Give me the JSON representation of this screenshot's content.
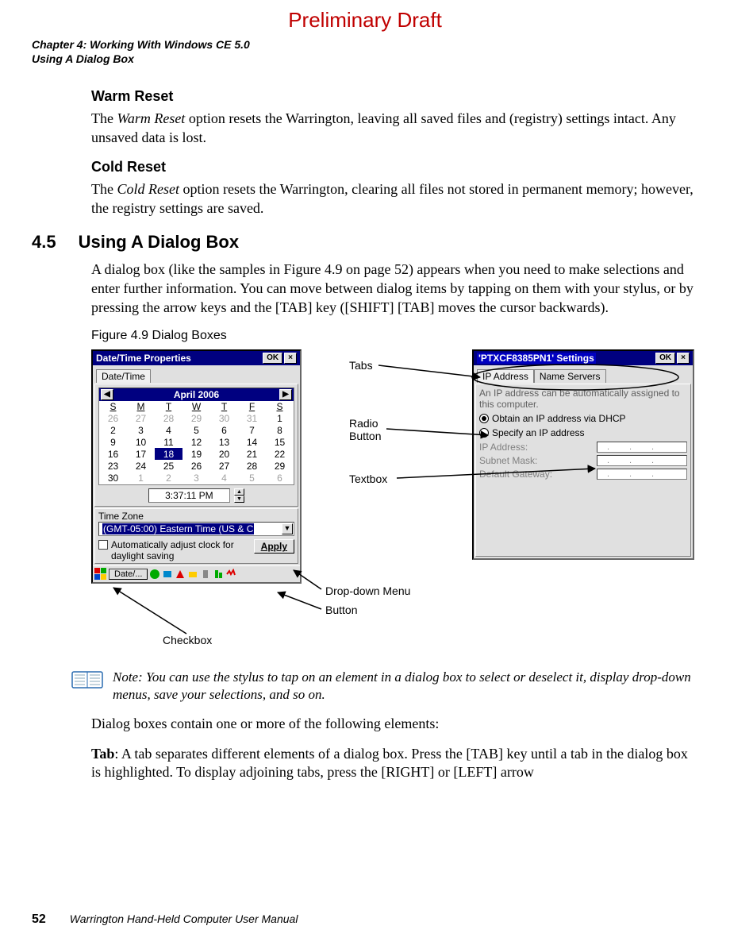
{
  "watermark": "Preliminary Draft",
  "running_head": {
    "chapter": "Chapter 4:  Working With Windows CE 5.0",
    "section": "Using A Dialog Box"
  },
  "warm_reset": {
    "heading": "Warm Reset",
    "body_pre": "The ",
    "body_em": "Warm Reset",
    "body_post": " option resets the Warrington, leaving all saved files and (registry) settings intact. Any unsaved data is lost."
  },
  "cold_reset": {
    "heading": "Cold Reset",
    "body_pre": "The ",
    "body_em": "Cold Reset",
    "body_post": " option resets the Warrington, clearing all files not stored in permanent memory; however, the registry settings are saved."
  },
  "section45": {
    "num": "4.5",
    "title": "Using A Dialog Box",
    "body": "A dialog box (like the samples in Figure 4.9 on page 52) appears when you need to make selections and enter further information. You can move between dialog items by tapping on them with your stylus, or by pressing the arrow keys and the [TAB] key ([SHIFT] [TAB] moves the cursor backwards)."
  },
  "fig_caption": "Figure 4.9  Dialog Boxes",
  "win1": {
    "title": "Date/Time Properties",
    "ok": "OK",
    "close": "×",
    "tab": "Date/Time",
    "month": "April 2006",
    "dow": [
      "S",
      "M",
      "T",
      "W",
      "T",
      "F",
      "S"
    ],
    "grid": [
      [
        {
          "v": "26",
          "d": 1
        },
        {
          "v": "27",
          "d": 1
        },
        {
          "v": "28",
          "d": 1
        },
        {
          "v": "29",
          "d": 1
        },
        {
          "v": "30",
          "d": 1
        },
        {
          "v": "31",
          "d": 1
        },
        {
          "v": "1",
          "d": 0
        }
      ],
      [
        {
          "v": "2",
          "d": 0
        },
        {
          "v": "3",
          "d": 0
        },
        {
          "v": "4",
          "d": 0
        },
        {
          "v": "5",
          "d": 0
        },
        {
          "v": "6",
          "d": 0
        },
        {
          "v": "7",
          "d": 0
        },
        {
          "v": "8",
          "d": 0
        }
      ],
      [
        {
          "v": "9",
          "d": 0
        },
        {
          "v": "10",
          "d": 0
        },
        {
          "v": "11",
          "d": 0
        },
        {
          "v": "12",
          "d": 0
        },
        {
          "v": "13",
          "d": 0
        },
        {
          "v": "14",
          "d": 0
        },
        {
          "v": "15",
          "d": 0
        }
      ],
      [
        {
          "v": "16",
          "d": 0
        },
        {
          "v": "17",
          "d": 0
        },
        {
          "v": "18",
          "s": 1
        },
        {
          "v": "19",
          "d": 0
        },
        {
          "v": "20",
          "d": 0
        },
        {
          "v": "21",
          "d": 0
        },
        {
          "v": "22",
          "d": 0
        }
      ],
      [
        {
          "v": "23",
          "d": 0
        },
        {
          "v": "24",
          "d": 0
        },
        {
          "v": "25",
          "d": 0
        },
        {
          "v": "26",
          "d": 0
        },
        {
          "v": "27",
          "d": 0
        },
        {
          "v": "28",
          "d": 0
        },
        {
          "v": "29",
          "d": 0
        }
      ],
      [
        {
          "v": "30",
          "d": 0
        },
        {
          "v": "1",
          "d": 1
        },
        {
          "v": "2",
          "d": 1
        },
        {
          "v": "3",
          "d": 1
        },
        {
          "v": "4",
          "d": 1
        },
        {
          "v": "5",
          "d": 1
        },
        {
          "v": "6",
          "d": 1
        }
      ]
    ],
    "time": "3:37:11 PM",
    "tz_label": "Time Zone",
    "tz_value": "(GMT-05:00) Eastern Time (US & C",
    "chk_label": "Automatically adjust clock for daylight saving",
    "apply": "Apply",
    "taskbtn": "Date/..."
  },
  "win2": {
    "title": "'PTXCF8385PN1' Settings",
    "ok": "OK",
    "close": "×",
    "tab1": "IP Address",
    "tab2": "Name Servers",
    "desc": "An IP address can be automatically assigned to this computer.",
    "radio1": "Obtain an IP address via DHCP",
    "radio2": "Specify an IP address",
    "ip_label": "IP Address:",
    "mask_label": "Subnet Mask:",
    "gw_label": "Default Gateway:"
  },
  "annot": {
    "tabs": "Tabs",
    "radio": "Radio Button",
    "textbox": "Textbox",
    "dropdown": "Drop-down Menu",
    "button": "Button",
    "checkbox": "Checkbox"
  },
  "note": {
    "lead": "Note: ",
    "body": "You can use the stylus to tap on an element in a dialog box to select or deselect it, display drop-down menus, save your selections, and so on."
  },
  "after_note": "Dialog boxes contain one or more of the following elements:",
  "tab_def": {
    "lead": "Tab",
    "body": ": A tab separates different elements of a dialog box. Press the [TAB] key until a tab in the dialog box is highlighted. To display adjoining tabs, press the [RIGHT] or [LEFT] arrow"
  },
  "footer": {
    "page": "52",
    "manual": "Warrington Hand-Held Computer User Manual"
  }
}
